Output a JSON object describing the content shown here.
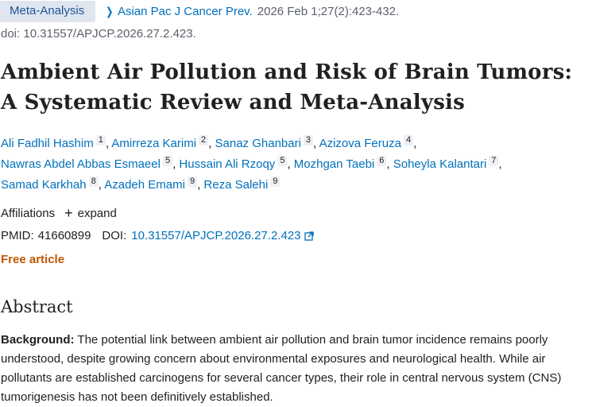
{
  "header": {
    "publication_type": "Meta-Analysis",
    "journal": "Asian Pac J Cancer Prev.",
    "citation": "2026 Feb 1;27(2):423-432.",
    "doi_line": "doi: 10.31557/APJCP.2026.27.2.423."
  },
  "article": {
    "title": "Ambient Air Pollution and Risk of Brain Tumors: A Systematic Review and Meta-Analysis"
  },
  "authors": [
    {
      "name": "Ali Fadhil Hashim",
      "aff": "1"
    },
    {
      "name": "Amirreza Karimi",
      "aff": "2"
    },
    {
      "name": "Sanaz Ghanbari",
      "aff": "3"
    },
    {
      "name": "Azizova Feruza",
      "aff": "4"
    },
    {
      "name": "Nawras Abdel Abbas Esmaeel",
      "aff": "5"
    },
    {
      "name": "Hussain Ali Rzoqy",
      "aff": "5"
    },
    {
      "name": "Mozhgan Taebi",
      "aff": "6"
    },
    {
      "name": "Soheyla Kalantari",
      "aff": "7"
    },
    {
      "name": "Samad Karkhah",
      "aff": "8"
    },
    {
      "name": "Azadeh Emami",
      "aff": "9"
    },
    {
      "name": "Reza Salehi",
      "aff": "9"
    }
  ],
  "affiliations": {
    "label": "Affiliations",
    "expand_label": "expand"
  },
  "ids": {
    "pmid_label": "PMID:",
    "pmid": "41660899",
    "doi_label": "DOI:",
    "doi": "10.31557/APJCP.2026.27.2.423"
  },
  "free_article": "Free article",
  "abstract": {
    "heading": "Abstract",
    "background_label": "Background:",
    "background_text": "The potential link between ambient air pollution and brain tumor incidence remains poorly understood, despite growing concern about environmental exposures and neurological health. While air pollutants are established carcinogens for several cancer types, their role in central nervous system (CNS) tumorigenesis has not been definitively established."
  },
  "colors": {
    "link": "#0071bc",
    "free": "#c05600",
    "badge_bg": "#dfe6ef"
  },
  "icons": {
    "chevron": "chevron-right-icon",
    "plus": "plus-icon",
    "external": "external-link-icon"
  }
}
